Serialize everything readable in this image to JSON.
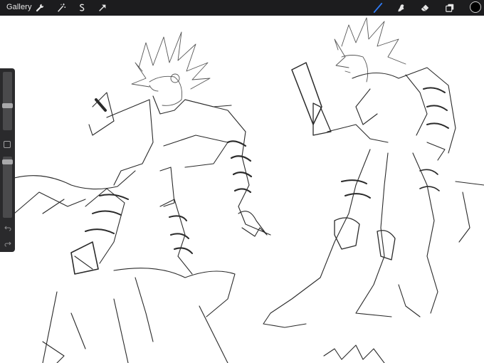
{
  "app": {
    "gallery_label": "Gallery"
  },
  "toolbar": {
    "left_icons": [
      "wrench-icon",
      "magic-wand-icon",
      "selection-s-icon",
      "transform-arrow-icon"
    ],
    "right_icons": [
      "brush-icon",
      "smudge-icon",
      "eraser-icon",
      "layers-icon"
    ],
    "active_tool": "brush",
    "active_tool_color": "#2f7bf5",
    "current_color": "#000000"
  },
  "sidebar": {
    "brush_size_level": 0.55,
    "opacity_level": 0.1,
    "icons": [
      "modify-square-icon",
      "undo-icon",
      "redo-icon"
    ]
  },
  "colors": {
    "bar_bg": "#1c1c1e",
    "canvas_bg": "#ffffff",
    "sketch_stroke": "#2a2a2a"
  }
}
